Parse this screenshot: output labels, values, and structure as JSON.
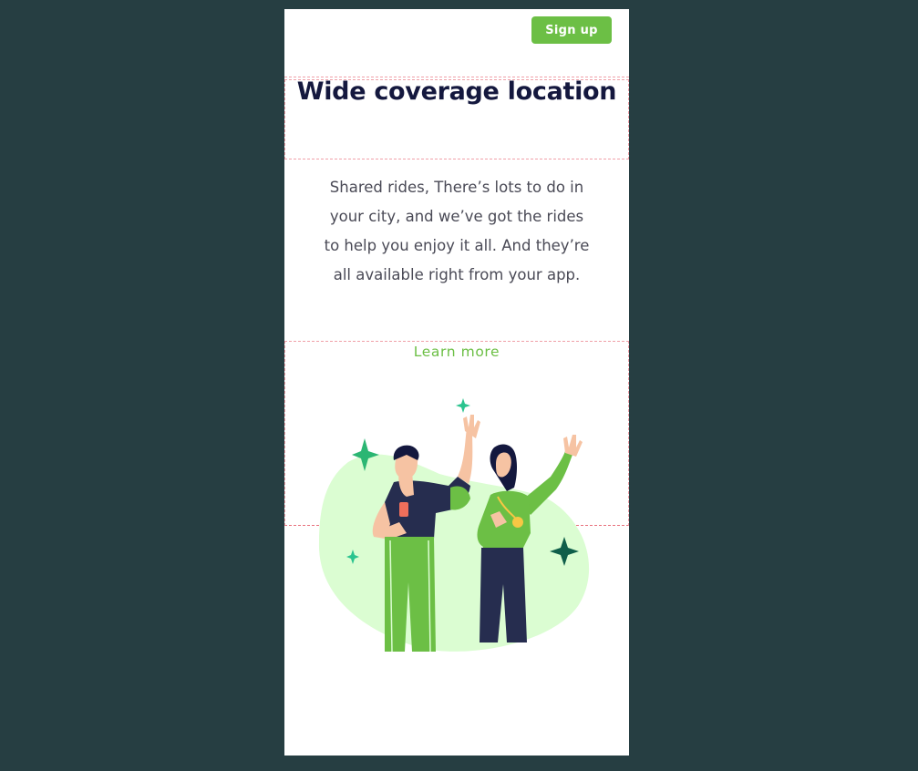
{
  "header": {
    "signup_label": "Sign up"
  },
  "hero": {
    "title": "Wide coverage location",
    "description": "Shared rides, There’s lots to do in your city, and we’ve got the rides to help you enjoy it all. And they’re all available right from your app.",
    "link_label": "Learn more"
  },
  "illustration": {
    "name": "people-waving-illustration"
  },
  "colors": {
    "background": "#263e42",
    "accent": "#6cbf45",
    "title": "#14183e",
    "blob": "#dbfdd2"
  }
}
